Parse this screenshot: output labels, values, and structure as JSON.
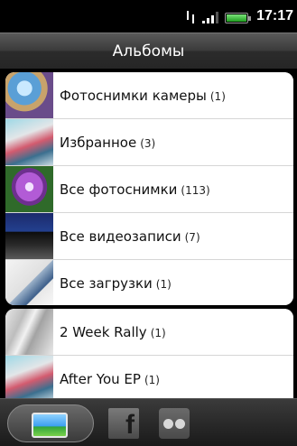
{
  "status_bar": {
    "time": "17:17",
    "icons": [
      "sync-icon",
      "signal-icon",
      "battery-icon"
    ]
  },
  "header": {
    "title": "Альбомы"
  },
  "albums_main": [
    {
      "label": "Фотоснимки камеры",
      "count": "(1)",
      "thumb": "camera-photo-thumbnail"
    },
    {
      "label": "Избранное",
      "count": "(3)",
      "thumb": "favorites-thumbnail"
    },
    {
      "label": "Все фотоснимки",
      "count": "(113)",
      "thumb": "all-photos-thumbnail"
    },
    {
      "label": "Все видеозаписи",
      "count": "(7)",
      "thumb": "all-videos-thumbnail"
    },
    {
      "label": "Все загрузки",
      "count": "(1)",
      "thumb": "downloads-thumbnail"
    }
  ],
  "albums_other": [
    {
      "label": "2 Week Rally",
      "count": "(1)",
      "thumb": "album-art-thumbnail"
    },
    {
      "label": "After You EP",
      "count": "(1)",
      "thumb": "album-art-thumbnail"
    }
  ],
  "bottom_tabs": [
    {
      "name": "albums",
      "icon": "gallery-icon"
    },
    {
      "name": "facebook",
      "icon": "facebook-icon"
    },
    {
      "name": "flickr",
      "icon": "flickr-icon"
    }
  ],
  "colors": {
    "list_background": "#ffffff",
    "screen_background": "#000000",
    "text": "#111111"
  }
}
